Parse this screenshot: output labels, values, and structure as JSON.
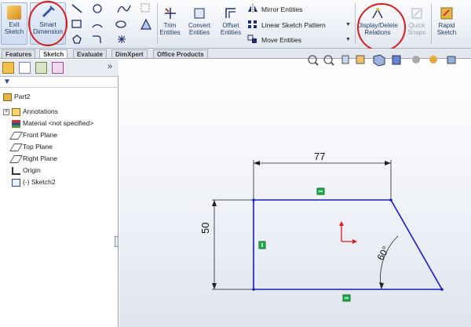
{
  "ribbon": {
    "exit_sketch": "Exit Sketch",
    "smart_dimension": "Smart Dimension",
    "trim_entities": "Trim Entities",
    "convert_entities": "Convert Entities",
    "offset_entities": "Offset Entities",
    "mirror_entities": "Mirror Entities",
    "linear_sketch_pattern": "Linear Sketch Pattern",
    "move_entities": "Move Entities",
    "display_delete_relations": "Display/Delete Relations",
    "quick_snaps": "Quick Snaps",
    "rapid_sketch": "Rapid Sketch"
  },
  "tabs": [
    {
      "label": "Features"
    },
    {
      "label": "Sketch"
    },
    {
      "label": "Evaluate"
    },
    {
      "label": "DimXpert"
    },
    {
      "label": "Office Products"
    }
  ],
  "tree": {
    "root": "Part2",
    "items": [
      {
        "label": "Annotations"
      },
      {
        "label": "Material <not specified>"
      },
      {
        "label": "Front Plane"
      },
      {
        "label": "Top Plane"
      },
      {
        "label": "Right Plane"
      },
      {
        "label": "Origin"
      },
      {
        "label": "(-) Sketch2"
      }
    ]
  },
  "sketch": {
    "dim_width": "77",
    "dim_height": "50",
    "dim_angle": "60°"
  },
  "colors": {
    "sketch_line": "#1a1ad0",
    "highlight": "#d81d1d",
    "relation_badge": "#22b14c"
  }
}
